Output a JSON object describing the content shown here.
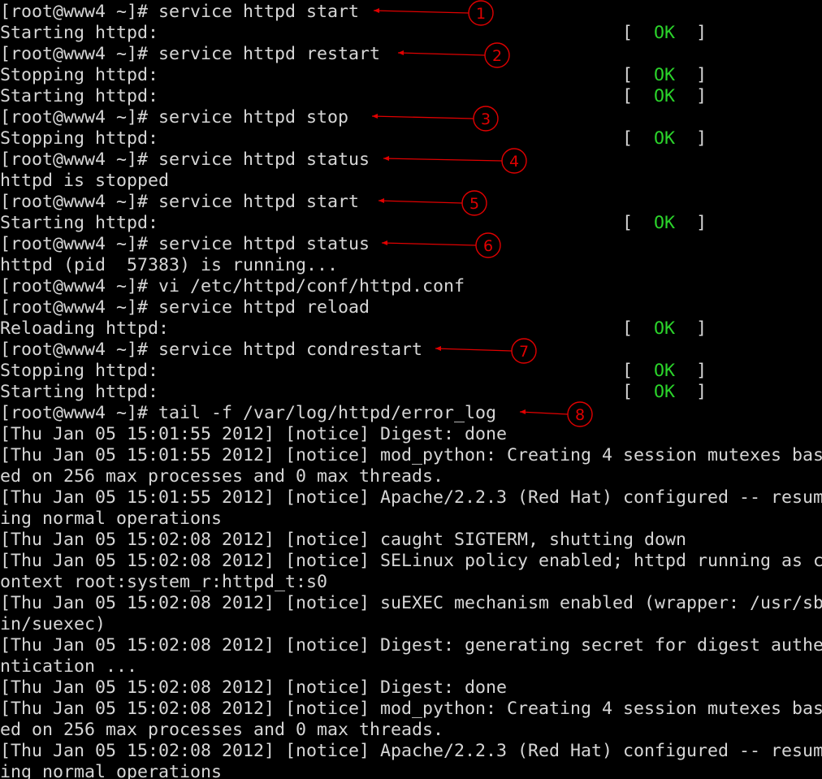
{
  "terminal": {
    "lines": [
      "[root@www4 ~]# service httpd start",
      "Starting httpd:",
      "[root@www4 ~]# service httpd restart",
      "Stopping httpd:",
      "Starting httpd:",
      "[root@www4 ~]# service httpd stop",
      "Stopping httpd:",
      "[root@www4 ~]# service httpd status",
      "httpd is stopped",
      "[root@www4 ~]# service httpd start",
      "Starting httpd:",
      "[root@www4 ~]# service httpd status",
      "httpd (pid  57383) is running...",
      "[root@www4 ~]# vi /etc/httpd/conf/httpd.conf",
      "[root@www4 ~]# service httpd reload",
      "Reloading httpd:",
      "[root@www4 ~]# service httpd condrestart",
      "Stopping httpd:",
      "Starting httpd:",
      "[root@www4 ~]# tail -f /var/log/httpd/error_log",
      "[Thu Jan 05 15:01:55 2012] [notice] Digest: done",
      "[Thu Jan 05 15:01:55 2012] [notice] mod_python: Creating 4 session mutexes bas",
      "ed on 256 max processes and 0 max threads.",
      "[Thu Jan 05 15:01:55 2012] [notice] Apache/2.2.3 (Red Hat) configured -- resum",
      "ing normal operations",
      "[Thu Jan 05 15:02:08 2012] [notice] caught SIGTERM, shutting down",
      "[Thu Jan 05 15:02:08 2012] [notice] SELinux policy enabled; httpd running as c",
      "ontext root:system_r:httpd_t:s0",
      "[Thu Jan 05 15:02:08 2012] [notice] suEXEC mechanism enabled (wrapper: /usr/sb",
      "in/suexec)",
      "[Thu Jan 05 15:02:08 2012] [notice] Digest: generating secret for digest authe",
      "ntication ...",
      "[Thu Jan 05 15:02:08 2012] [notice] Digest: done",
      "[Thu Jan 05 15:02:08 2012] [notice] mod_python: Creating 4 session mutexes bas",
      "ed on 256 max processes and 0 max threads.",
      "[Thu Jan 05 15:02:08 2012] [notice] Apache/2.2.3 (Red Hat) configured -- resum",
      "ing normal operations"
    ],
    "ok_lines": [
      1,
      3,
      4,
      6,
      10,
      15,
      17,
      18
    ],
    "ok_text": "OK",
    "bracket_open": "[",
    "bracket_close": "]"
  },
  "annotations": {
    "markers": [
      {
        "label": "1",
        "line": 0
      },
      {
        "label": "2",
        "line": 2
      },
      {
        "label": "3",
        "line": 5
      },
      {
        "label": "4",
        "line": 7
      },
      {
        "label": "5",
        "line": 9
      },
      {
        "label": "6",
        "line": 11
      },
      {
        "label": "7",
        "line": 16
      },
      {
        "label": "8",
        "line": 19
      }
    ]
  },
  "colors": {
    "background": "#000000",
    "text": "#d6d6d6",
    "ok": "#2bd42b",
    "annotation": "#e00000"
  }
}
